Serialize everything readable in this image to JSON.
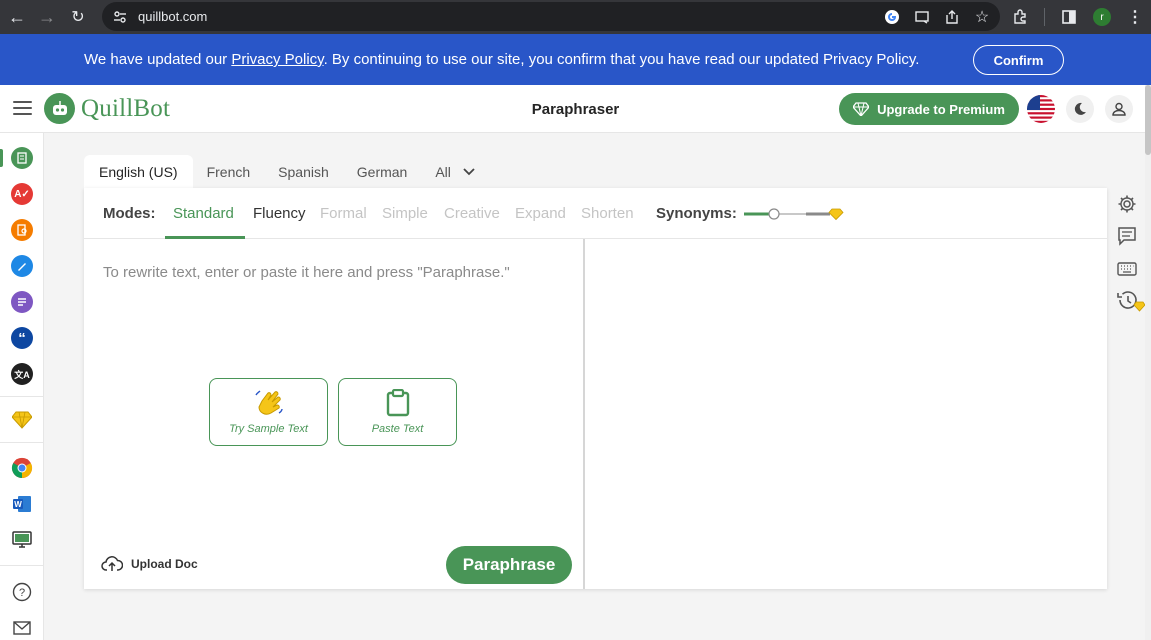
{
  "browser": {
    "url": "quillbot.com",
    "profile_initial": "r"
  },
  "banner": {
    "text_before": "We have updated our ",
    "link_text": "Privacy Policy",
    "text_after": ". By continuing to use our site, you confirm that you have read our updated Privacy Policy.",
    "confirm_label": "Confirm"
  },
  "header": {
    "logo_text": "QuillBot",
    "title": "Paraphraser",
    "premium_label": "Upgrade to Premium"
  },
  "languages": {
    "tabs": [
      "English (US)",
      "French",
      "Spanish",
      "German"
    ],
    "all_label": "All",
    "selected": "English (US)"
  },
  "modes": {
    "label": "Modes:",
    "items": [
      "Standard",
      "Fluency",
      "Formal",
      "Simple",
      "Creative",
      "Expand",
      "Shorten"
    ],
    "selected": "Standard"
  },
  "synonyms": {
    "label": "Synonyms:",
    "level": 0.25
  },
  "editor": {
    "placeholder": "To rewrite text, enter or paste it here and press \"Paraphrase.\"",
    "sample_label": "Try Sample Text",
    "paste_label": "Paste Text",
    "upload_label": "Upload Doc",
    "paraphrase_label": "Paraphrase"
  },
  "colors": {
    "brand_green": "#499557",
    "banner_blue": "#2956c8",
    "premium_gold": "#f5c518"
  }
}
